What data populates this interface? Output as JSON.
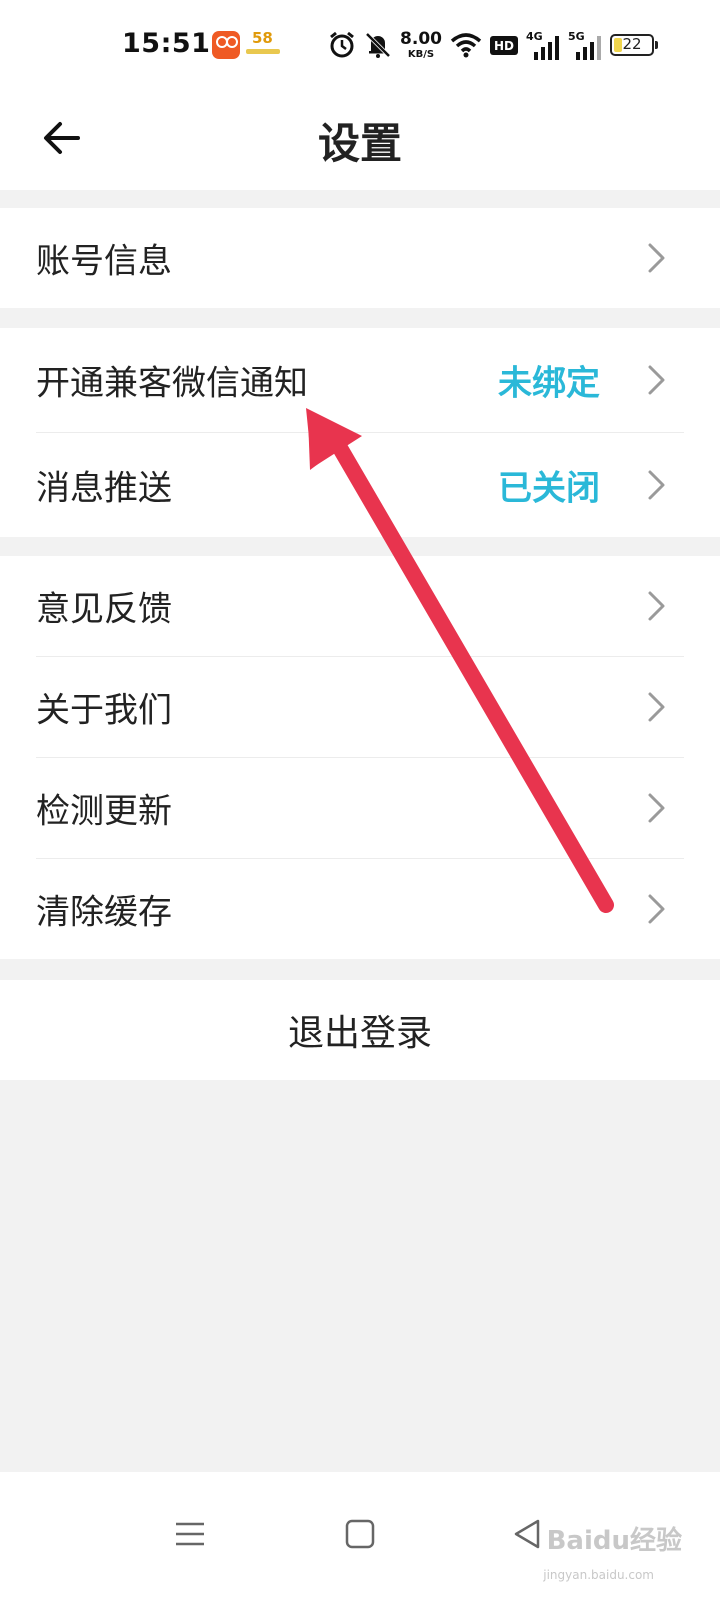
{
  "status_bar": {
    "time": "15:51",
    "net_speed_value": "8.00",
    "net_speed_unit": "KB/S",
    "hd_label": "HD",
    "net1": "4G",
    "net2": "5G",
    "battery_level": "22",
    "app_icon_2_text": "58",
    "icons": [
      "app-icon",
      "app-icon",
      "alarm-icon",
      "mute-bell-icon",
      "wifi-icon",
      "hd-icon",
      "signal-icon",
      "signal-icon",
      "battery-icon"
    ]
  },
  "header": {
    "title": "设置",
    "back_icon": "arrow-left-icon"
  },
  "groups": [
    {
      "rows": [
        {
          "label": "账号信息",
          "value": ""
        }
      ]
    },
    {
      "rows": [
        {
          "label": "开通兼客微信通知",
          "value": "未绑定"
        },
        {
          "label": "消息推送",
          "value": "已关闭"
        }
      ]
    },
    {
      "rows": [
        {
          "label": "意见反馈",
          "value": ""
        },
        {
          "label": "关于我们",
          "value": ""
        },
        {
          "label": "检测更新",
          "value": ""
        },
        {
          "label": "清除缓存",
          "value": ""
        }
      ]
    }
  ],
  "logout_label": "退出登录",
  "colors": {
    "accent": "#2ab8d8",
    "annotation_arrow": "#e8344e",
    "background": "#f2f2f2"
  },
  "watermark": {
    "main": "Baidu经验",
    "sub": "jingyan.baidu.com"
  }
}
